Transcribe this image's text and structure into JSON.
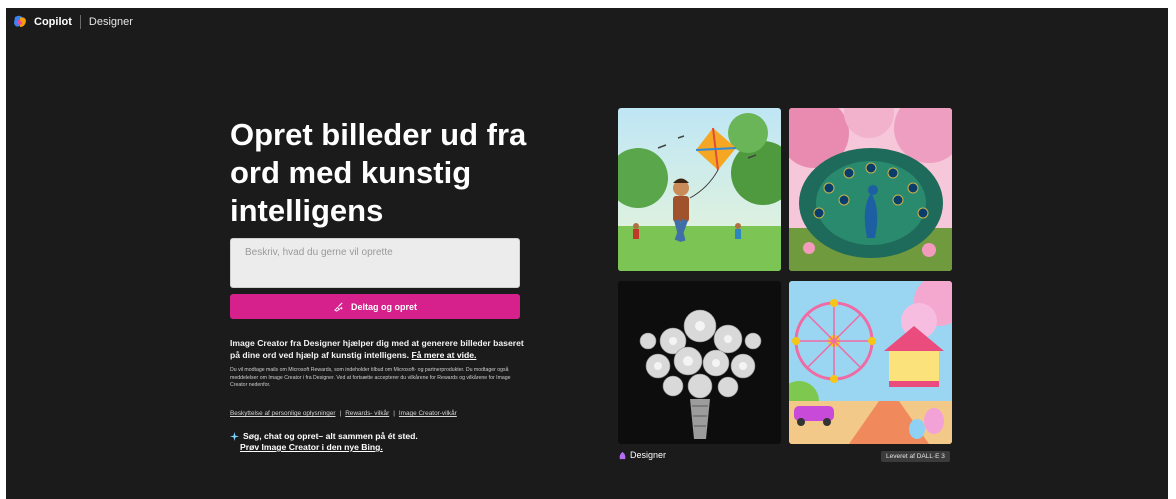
{
  "header": {
    "brand": "Copilot",
    "product": "Designer"
  },
  "hero": {
    "headline": "Opret billeder ud fra ord med kunstig intelligens",
    "prompt_placeholder": "Beskriv, hvad du gerne vil oprette",
    "cta_label": "Deltag og opret"
  },
  "info": {
    "description": "Image Creator fra Designer hjælper dig med at generere billeder baseret på dine ord ved hjælp af kunstig intelligens.",
    "learn_more": "Få mere at vide.",
    "fine_print": "Du vil modtage mails om Microsoft Rewards, som indeholder tilbud om Microsoft- og partnerprodukter. Du modtager også meddelelser om Image Creator i fra Designer. Ved at fortsætte accepterer du vilkårene for Rewards og vilkårene for Image Creator nedenfor.",
    "links": [
      "Beskyttelse af personlige oplysninger",
      "Rewards- vilkår",
      "Image Creator-vilkår"
    ],
    "link_separator": "|",
    "bing_tagline": "Søg, chat og opret– alt sammen på ét sted.",
    "bing_link": "Prøv Image Creator i den nye Bing."
  },
  "gallery": {
    "images": [
      {
        "subject": "boy flying a kite in a park"
      },
      {
        "subject": "peacock under cherry blossoms"
      },
      {
        "subject": "silver jeweled flower bouquet"
      },
      {
        "subject": "colorful amusement park with ferris wheel"
      }
    ],
    "designer_label": "Designer",
    "powered_by": "Leveret af DALL·E 3"
  },
  "colors": {
    "accent": "#d6218c",
    "background": "#1b1b1b"
  }
}
